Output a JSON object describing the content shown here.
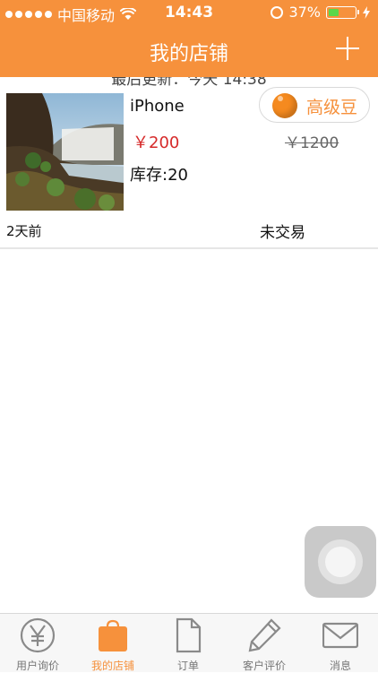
{
  "status_bar": {
    "carrier": "中国移动",
    "time": "14:43",
    "battery": "37%"
  },
  "nav": {
    "title": "我的店铺"
  },
  "refresh": {
    "text": "最后更新：今天 14:38"
  },
  "item": {
    "name": "iPhone",
    "price": "￥200",
    "stock": "库存:20",
    "badge_label": "高级豆",
    "original_price": "￥1200",
    "posted": "2天前",
    "trade_status": "未交易"
  },
  "tabs": [
    {
      "label": "用户询价",
      "icon": "yen-circle-icon",
      "active": false
    },
    {
      "label": "我的店铺",
      "icon": "shopping-bag-icon",
      "active": true
    },
    {
      "label": "订单",
      "icon": "document-icon",
      "active": false
    },
    {
      "label": "客户评价",
      "icon": "pencil-icon",
      "active": false
    },
    {
      "label": "消息",
      "icon": "envelope-icon",
      "active": false
    }
  ],
  "colors": {
    "accent": "#f6913c",
    "price": "#d62a2a"
  }
}
